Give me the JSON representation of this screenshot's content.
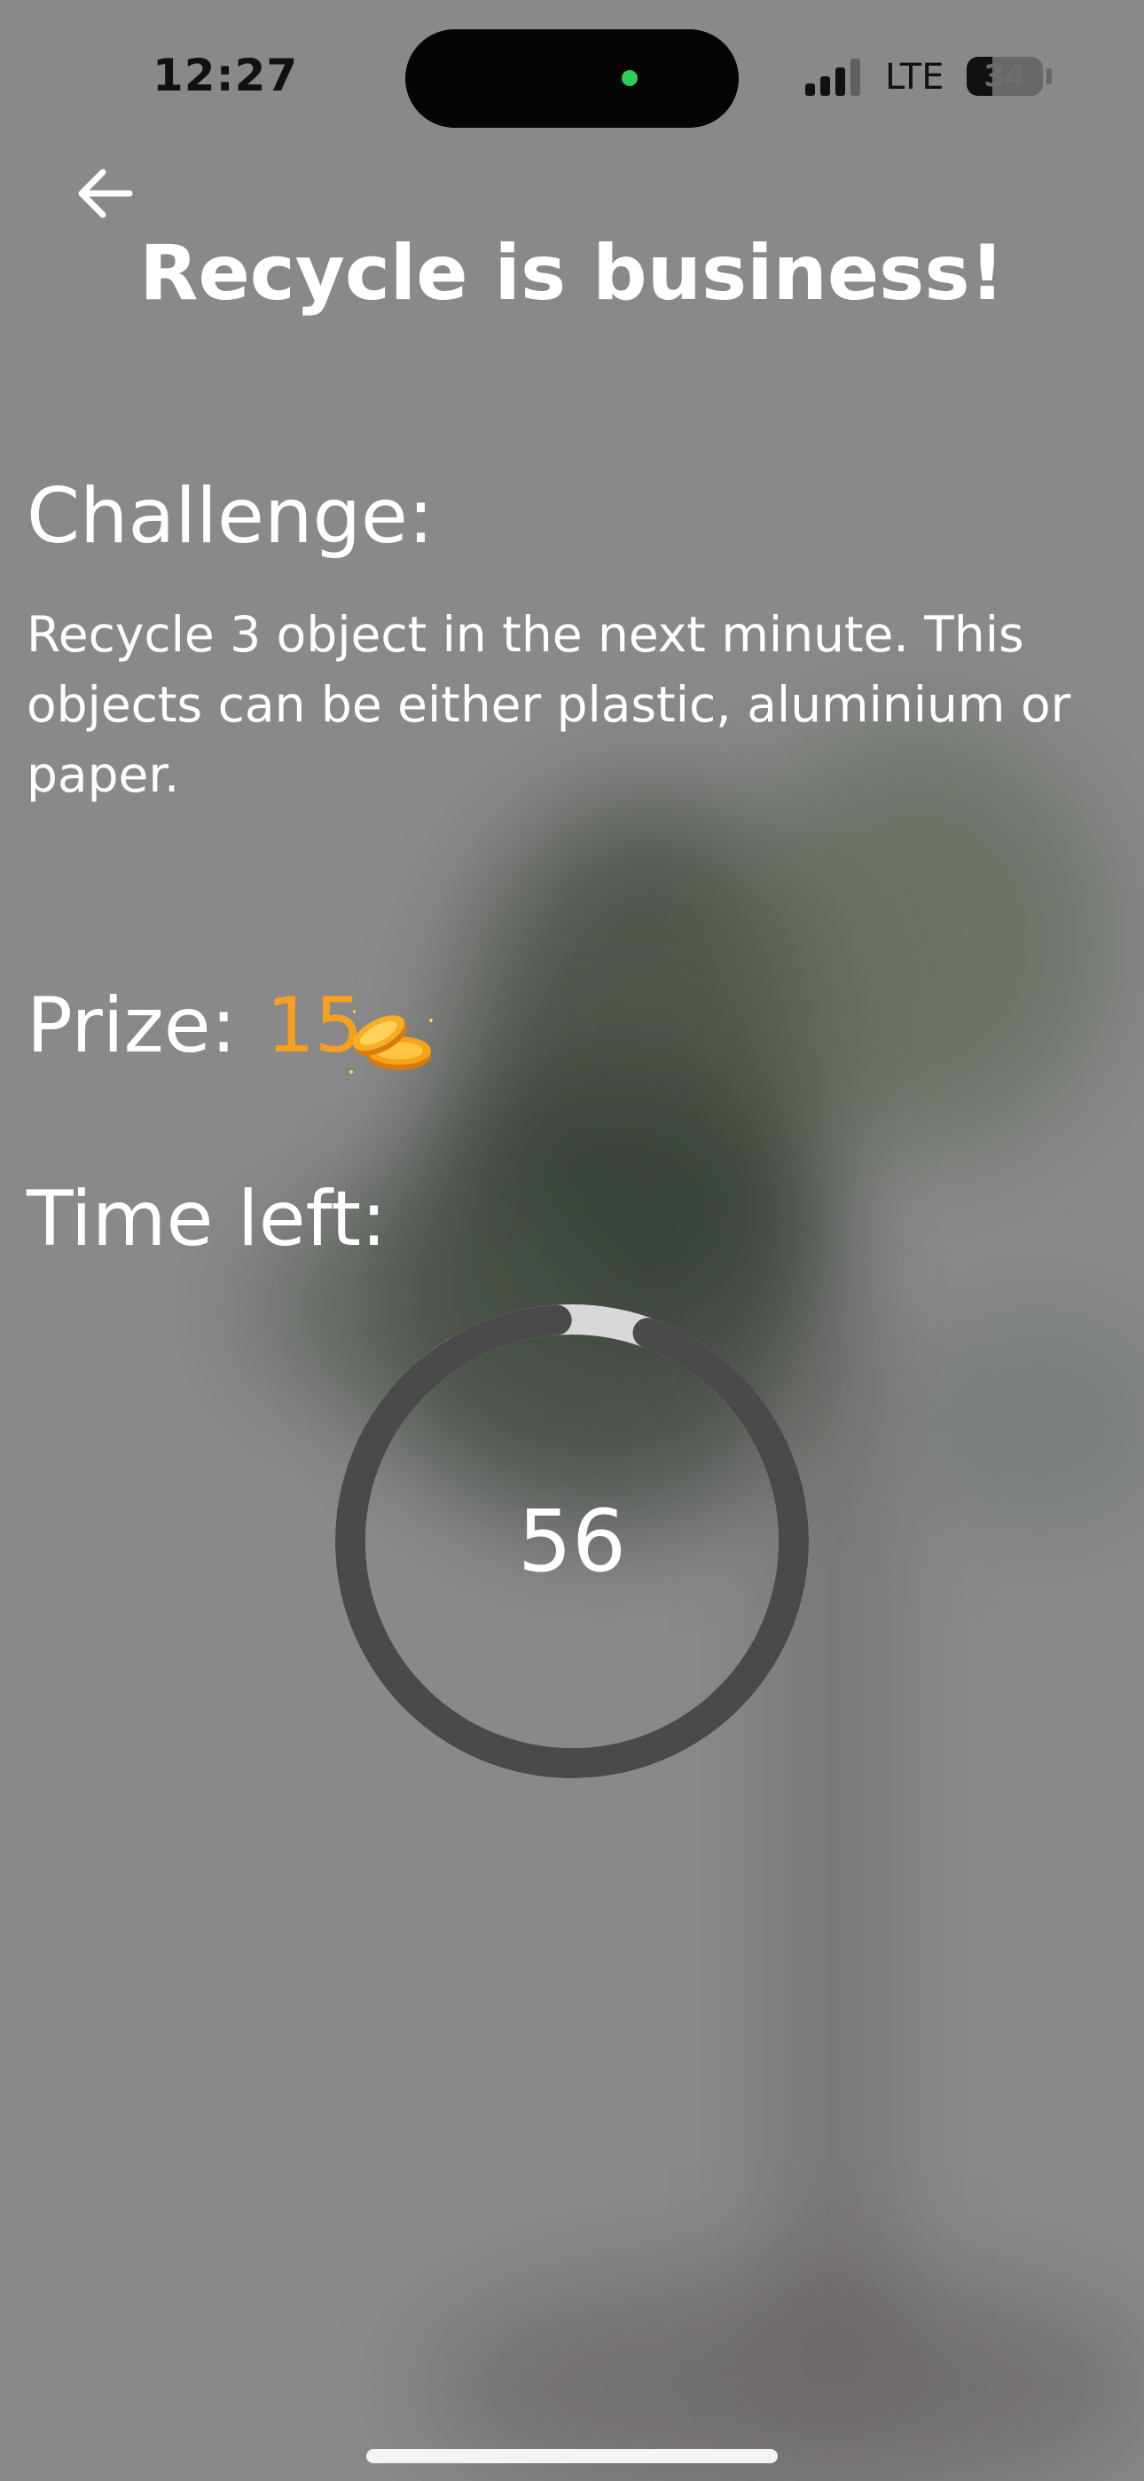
{
  "status_bar": {
    "time": "12:27",
    "network": "LTE",
    "battery": "34",
    "battery_level": 0.34
  },
  "header": {
    "back_icon": "arrow-left-icon",
    "title": "Recycle is business!"
  },
  "challenge": {
    "heading": "Challenge:",
    "description": "Recycle 3 object in the next minute. This objects can be either plastic, aluminium or paper."
  },
  "prize": {
    "label": "Prize:",
    "value": "15",
    "icon": "coins-icon",
    "color": "#f5a01f"
  },
  "timer": {
    "label": "Time left:",
    "seconds": "56",
    "progress_fraction": 0.9333
  },
  "colors": {
    "ring_track": "#4a4a4a",
    "ring_remaining": "#d8d8d8",
    "text": "#ffffff",
    "accent": "#f5a01f"
  }
}
